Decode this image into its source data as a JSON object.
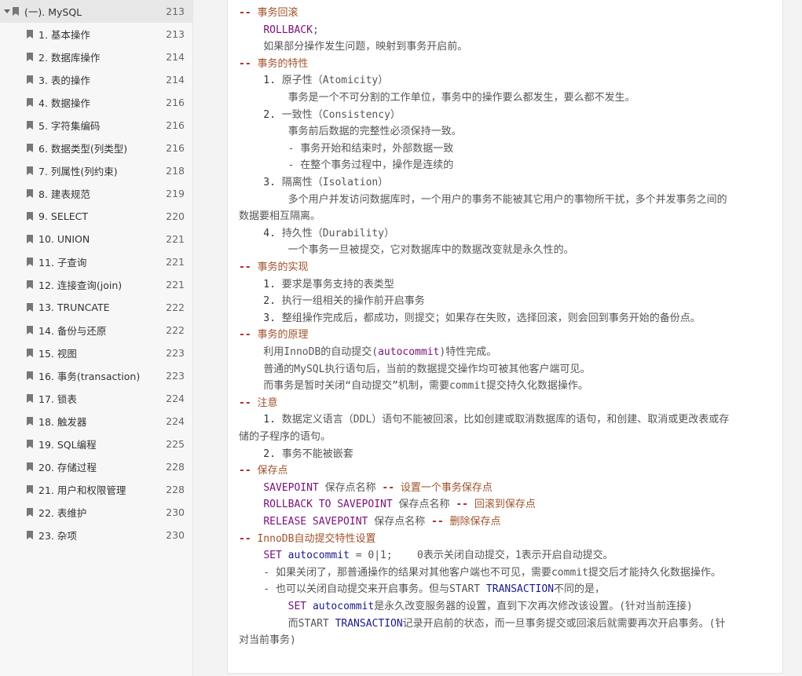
{
  "sidebar": {
    "items": [
      {
        "label": "(一). MySQL",
        "page": "213",
        "active": true,
        "expandable": true
      },
      {
        "label": "1. 基本操作",
        "page": "213"
      },
      {
        "label": "2. 数据库操作",
        "page": "214"
      },
      {
        "label": "3. 表的操作",
        "page": "214"
      },
      {
        "label": "4. 数据操作",
        "page": "216"
      },
      {
        "label": "5. 字符集编码",
        "page": "216"
      },
      {
        "label": "6. 数据类型(列类型)",
        "page": "216"
      },
      {
        "label": "7. 列属性(列约束)",
        "page": "218"
      },
      {
        "label": "8. 建表规范",
        "page": "219"
      },
      {
        "label": "9. SELECT",
        "page": "220"
      },
      {
        "label": "10. UNION",
        "page": "221"
      },
      {
        "label": "11. 子查询",
        "page": "221"
      },
      {
        "label": "12. 连接查询(join)",
        "page": "221"
      },
      {
        "label": "13. TRUNCATE",
        "page": "222"
      },
      {
        "label": "14. 备份与还原",
        "page": "222"
      },
      {
        "label": "15. 视图",
        "page": "223"
      },
      {
        "label": "16. 事务(transaction)",
        "page": "223"
      },
      {
        "label": "17. 锁表",
        "page": "224"
      },
      {
        "label": "18. 触发器",
        "page": "224"
      },
      {
        "label": "19. SQL编程",
        "page": "225"
      },
      {
        "label": "20. 存储过程",
        "page": "228"
      },
      {
        "label": "21. 用户和权限管理",
        "page": "228"
      },
      {
        "label": "22. 表维护",
        "page": "230"
      },
      {
        "label": "23. 杂项",
        "page": "230"
      }
    ]
  },
  "doc": {
    "lines": [
      {
        "segs": [
          {
            "t": "-- ",
            "c": "dash"
          },
          {
            "t": "事务回滚",
            "c": "cm"
          }
        ]
      },
      {
        "segs": [
          {
            "t": "    "
          },
          {
            "t": "ROLLBACK",
            "c": "kw"
          },
          {
            "t": ";"
          }
        ]
      },
      {
        "segs": [
          {
            "t": "    如果部分操作发生问题，映射到事务开启前。"
          }
        ]
      },
      {
        "segs": [
          {
            "t": "-- ",
            "c": "dash"
          },
          {
            "t": "事务的特性",
            "c": "cm"
          }
        ]
      },
      {
        "segs": [
          {
            "t": "    1. ",
            "c": "num"
          },
          {
            "t": "原子性（Atomicity）"
          }
        ]
      },
      {
        "segs": [
          {
            "t": "        事务是一个不可分割的工作单位，事务中的操作要么都发生，要么都不发生。"
          }
        ]
      },
      {
        "segs": [
          {
            "t": "    2. ",
            "c": "num"
          },
          {
            "t": "一致性（Consistency）"
          }
        ]
      },
      {
        "segs": [
          {
            "t": "        事务前后数据的完整性必须保持一致。"
          }
        ]
      },
      {
        "segs": [
          {
            "t": "        - 事务开始和结束时，外部数据一致"
          }
        ]
      },
      {
        "segs": [
          {
            "t": "        - 在整个事务过程中，操作是连续的"
          }
        ]
      },
      {
        "segs": [
          {
            "t": "    3. ",
            "c": "num"
          },
          {
            "t": "隔离性（Isolation）"
          }
        ]
      },
      {
        "segs": [
          {
            "t": "        多个用户并发访问数据库时，一个用户的事务不能被其它用户的事物所干扰，多个并发事务之间的"
          }
        ]
      },
      {
        "segs": [
          {
            "t": "数据要相互隔离。"
          }
        ]
      },
      {
        "segs": [
          {
            "t": "    4. ",
            "c": "num"
          },
          {
            "t": "持久性（Durability）"
          }
        ]
      },
      {
        "segs": [
          {
            "t": "        一个事务一旦被提交，它对数据库中的数据改变就是永久性的。"
          }
        ]
      },
      {
        "segs": [
          {
            "t": "-- ",
            "c": "dash"
          },
          {
            "t": "事务的实现",
            "c": "cm"
          }
        ]
      },
      {
        "segs": [
          {
            "t": "    1. ",
            "c": "num"
          },
          {
            "t": "要求是事务支持的表类型"
          }
        ]
      },
      {
        "segs": [
          {
            "t": "    2. ",
            "c": "num"
          },
          {
            "t": "执行一组相关的操作前开启事务"
          }
        ]
      },
      {
        "segs": [
          {
            "t": "    3. ",
            "c": "num"
          },
          {
            "t": "整组操作完成后，都成功，则提交；如果存在失败，选择回滚，则会回到事务开始的备份点。"
          }
        ]
      },
      {
        "segs": [
          {
            "t": "-- ",
            "c": "dash"
          },
          {
            "t": "事务的原理",
            "c": "cm"
          }
        ]
      },
      {
        "segs": [
          {
            "t": "    利用InnoDB的自动提交("
          },
          {
            "t": "autocommit",
            "c": "kw"
          },
          {
            "t": ")特性完成。"
          }
        ]
      },
      {
        "segs": [
          {
            "t": "    普通的MySQL执行语句后，当前的数据提交操作均可被其他客户端可见。"
          }
        ]
      },
      {
        "segs": [
          {
            "t": "    而事务是暂时关闭“自动提交”机制，需要commit提交持久化数据操作。"
          }
        ]
      },
      {
        "segs": [
          {
            "t": "-- ",
            "c": "dash"
          },
          {
            "t": "注意",
            "c": "cm"
          }
        ]
      },
      {
        "segs": [
          {
            "t": "    1. ",
            "c": "num"
          },
          {
            "t": "数据定义语言（DDL）语句不能被回滚，比如创建或取消数据库的语句，和创建、取消或更改表或存"
          }
        ]
      },
      {
        "segs": [
          {
            "t": "储的子程序的语句。"
          }
        ]
      },
      {
        "segs": [
          {
            "t": "    2. ",
            "c": "num"
          },
          {
            "t": "事务不能被嵌套"
          }
        ]
      },
      {
        "segs": [
          {
            "t": "-- ",
            "c": "dash"
          },
          {
            "t": "保存点",
            "c": "cm"
          }
        ]
      },
      {
        "segs": [
          {
            "t": "    "
          },
          {
            "t": "SAVEPOINT",
            "c": "kw"
          },
          {
            "t": " 保存点名称 "
          },
          {
            "t": "--",
            "c": "dash"
          },
          {
            "t": " 设置一个事务保存点",
            "c": "cm"
          }
        ]
      },
      {
        "segs": [
          {
            "t": "    "
          },
          {
            "t": "ROLLBACK TO SAVEPOINT",
            "c": "kw"
          },
          {
            "t": " 保存点名称 "
          },
          {
            "t": "--",
            "c": "dash"
          },
          {
            "t": " 回滚到保存点",
            "c": "cm"
          }
        ]
      },
      {
        "segs": [
          {
            "t": "    "
          },
          {
            "t": "RELEASE SAVEPOINT",
            "c": "kw"
          },
          {
            "t": " 保存点名称 "
          },
          {
            "t": "--",
            "c": "dash"
          },
          {
            "t": " 删除保存点",
            "c": "cm"
          }
        ]
      },
      {
        "segs": [
          {
            "t": "-- ",
            "c": "dash"
          },
          {
            "t": "InnoDB自动提交特性设置",
            "c": "cm"
          }
        ]
      },
      {
        "segs": [
          {
            "t": "    "
          },
          {
            "t": "SET",
            "c": "kw"
          },
          {
            "t": " "
          },
          {
            "t": "autocommit",
            "c": "kw2"
          },
          {
            "t": " = 0|1;    0表示关闭自动提交，1表示开启自动提交。"
          }
        ]
      },
      {
        "segs": [
          {
            "t": "    - 如果关闭了，那普通操作的结果对其他客户端也不可见，需要commit提交后才能持久化数据操作。"
          }
        ]
      },
      {
        "segs": [
          {
            "t": "    - 也可以关闭自动提交来开启事务。但与START "
          },
          {
            "t": "TRANSACTION",
            "c": "kw2"
          },
          {
            "t": "不同的是，"
          }
        ]
      },
      {
        "segs": [
          {
            "t": "        "
          },
          {
            "t": "SET",
            "c": "kw"
          },
          {
            "t": " "
          },
          {
            "t": "autocommit",
            "c": "kw2"
          },
          {
            "t": "是永久改变服务器的设置，直到下次再次修改该设置。(针对当前连接)"
          }
        ]
      },
      {
        "segs": [
          {
            "t": "        而START "
          },
          {
            "t": "TRANSACTION",
            "c": "kw2"
          },
          {
            "t": "记录开启前的状态，而一旦事务提交或回滚后就需要再次开启事务。(针"
          }
        ]
      },
      {
        "segs": [
          {
            "t": "对当前事务)"
          }
        ]
      }
    ]
  }
}
